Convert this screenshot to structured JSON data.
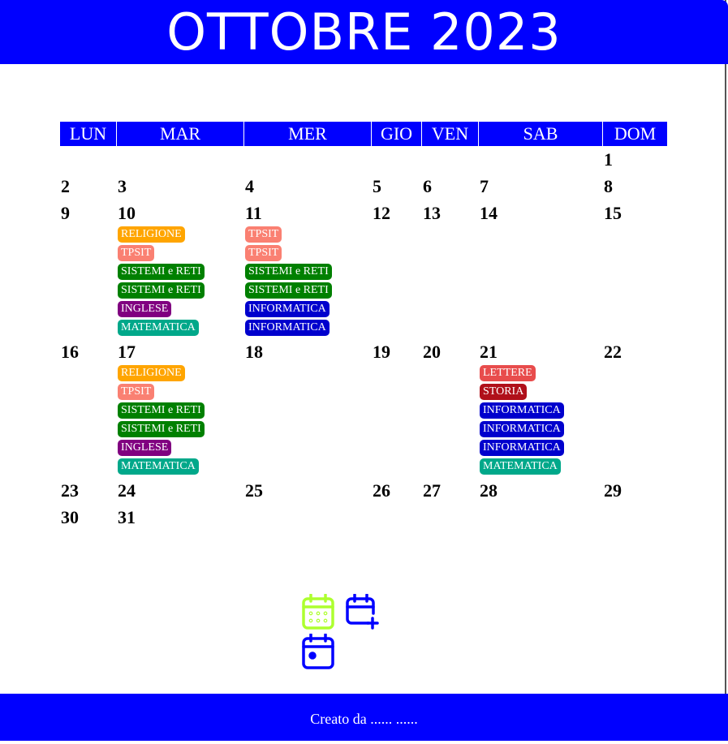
{
  "title": "OTTOBRE 2023",
  "weekdays": [
    "LUN",
    "MAR",
    "MER",
    "GIO",
    "VEN",
    "SAB",
    "DOM"
  ],
  "weeks": [
    [
      null,
      null,
      null,
      null,
      null,
      null,
      {
        "day": "1",
        "events": []
      }
    ],
    [
      {
        "day": "2",
        "events": []
      },
      {
        "day": "3",
        "events": []
      },
      {
        "day": "4",
        "events": []
      },
      {
        "day": "5",
        "events": []
      },
      {
        "day": "6",
        "events": []
      },
      {
        "day": "7",
        "events": []
      },
      {
        "day": "8",
        "events": []
      }
    ],
    [
      {
        "day": "9",
        "events": []
      },
      {
        "day": "10",
        "events": [
          {
            "label": "RELIGIONE",
            "color": "#ffa500"
          },
          {
            "label": "TPSIT",
            "color": "#fa8072"
          },
          {
            "label": "SISTEMI e RETI",
            "color": "#008000"
          },
          {
            "label": "SISTEMI e RETI",
            "color": "#008000"
          },
          {
            "label": "INGLESE",
            "color": "#800080"
          },
          {
            "label": "MATEMATICA",
            "color": "#00a88a"
          }
        ]
      },
      {
        "day": "11",
        "events": [
          {
            "label": "TPSIT",
            "color": "#fa8072"
          },
          {
            "label": "TPSIT",
            "color": "#fa8072"
          },
          {
            "label": "SISTEMI e RETI",
            "color": "#008000"
          },
          {
            "label": "SISTEMI e RETI",
            "color": "#008000"
          },
          {
            "label": "INFORMATICA",
            "color": "#0000cd"
          },
          {
            "label": "INFORMATICA",
            "color": "#0000cd"
          }
        ]
      },
      {
        "day": "12",
        "events": []
      },
      {
        "day": "13",
        "events": []
      },
      {
        "day": "14",
        "events": []
      },
      {
        "day": "15",
        "events": []
      }
    ],
    [
      {
        "day": "16",
        "events": []
      },
      {
        "day": "17",
        "events": [
          {
            "label": "RELIGIONE",
            "color": "#ffa500"
          },
          {
            "label": "TPSIT",
            "color": "#fa8072"
          },
          {
            "label": "SISTEMI e RETI",
            "color": "#008000"
          },
          {
            "label": "SISTEMI e RETI",
            "color": "#008000"
          },
          {
            "label": "INGLESE",
            "color": "#800080"
          },
          {
            "label": "MATEMATICA",
            "color": "#00a88a"
          }
        ]
      },
      {
        "day": "18",
        "events": []
      },
      {
        "day": "19",
        "events": []
      },
      {
        "day": "20",
        "events": []
      },
      {
        "day": "21",
        "events": [
          {
            "label": "LETTERE",
            "color": "#e84c4c"
          },
          {
            "label": "STORIA",
            "color": "#b0101a"
          },
          {
            "label": "INFORMATICA",
            "color": "#0000cd"
          },
          {
            "label": "INFORMATICA",
            "color": "#0000cd"
          },
          {
            "label": "INFORMATICA",
            "color": "#0000cd"
          },
          {
            "label": "MATEMATICA",
            "color": "#00a88a"
          }
        ]
      },
      {
        "day": "22",
        "events": []
      }
    ],
    [
      {
        "day": "23",
        "events": []
      },
      {
        "day": "24",
        "events": []
      },
      {
        "day": "25",
        "events": []
      },
      {
        "day": "26",
        "events": []
      },
      {
        "day": "27",
        "events": []
      },
      {
        "day": "28",
        "events": []
      },
      {
        "day": "29",
        "events": []
      }
    ],
    [
      {
        "day": "30",
        "events": []
      },
      {
        "day": "31",
        "events": []
      },
      null,
      null,
      null,
      null,
      null
    ]
  ],
  "icons": [
    {
      "name": "calendar-grid-icon",
      "color": "#adff2f"
    },
    {
      "name": "calendar-add-icon",
      "color": "#0000ff"
    },
    {
      "name": "calendar-day-icon",
      "color": "#0000ff"
    }
  ],
  "footer": "Creato da ...... ......",
  "colors": {
    "brand": "#0000ff",
    "background": "#ffffff"
  }
}
